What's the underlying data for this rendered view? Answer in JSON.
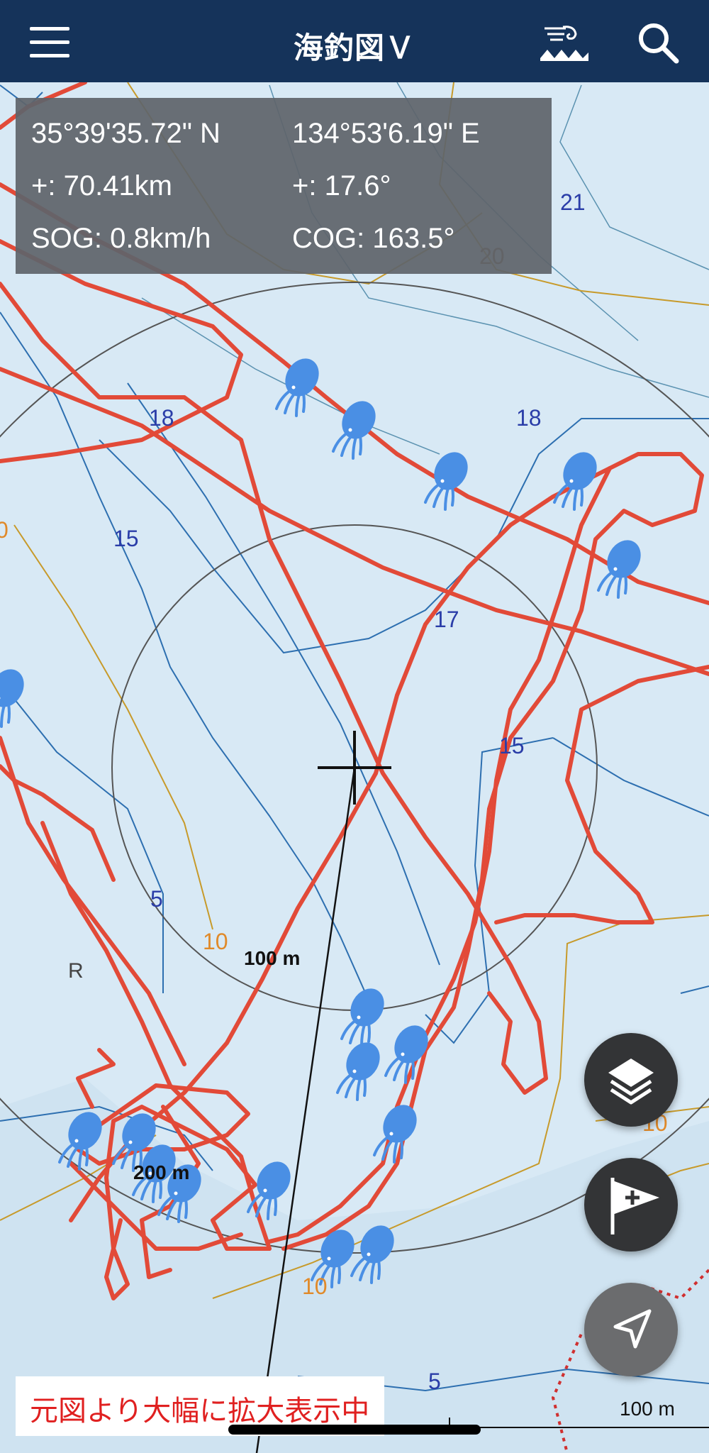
{
  "header": {
    "title": "海釣図Ｖ",
    "menu_icon": "hamburger-menu-icon",
    "tide_icon": "tide-wave-icon",
    "search_icon": "search-icon"
  },
  "info_panel": {
    "latitude": "35°39'35.72\" N",
    "longitude": "134°53'6.19\" E",
    "distance": "+: 70.41km",
    "bearing": "+: 17.6°",
    "sog": "SOG: 0.8km/h",
    "cog": "COG: 163.5°"
  },
  "map": {
    "depth_labels": {
      "d21": "21",
      "d20": "20",
      "d18a": "18",
      "d18b": "18",
      "d15a": "15",
      "d17": "17",
      "d15b": "15",
      "d5a": "5",
      "d10a": "10",
      "d10b": "10",
      "d10c": "10",
      "d5b": "5",
      "d0": "0"
    },
    "seabed_label": "R",
    "ring_inner_label": "100 m",
    "ring_outer_label": "200 m",
    "track_color": "#e24a38",
    "marker_icon": "octopus-icon",
    "marker_color": "#4a8fe4"
  },
  "controls": {
    "layers_button_icon": "layers-icon",
    "add_flag_button_icon": "flag-plus-icon",
    "locate_button_icon": "navigation-arrow-icon"
  },
  "notice": {
    "text": "元図より大幅に拡大表示中"
  },
  "scale_bar": {
    "label": "100 m"
  }
}
